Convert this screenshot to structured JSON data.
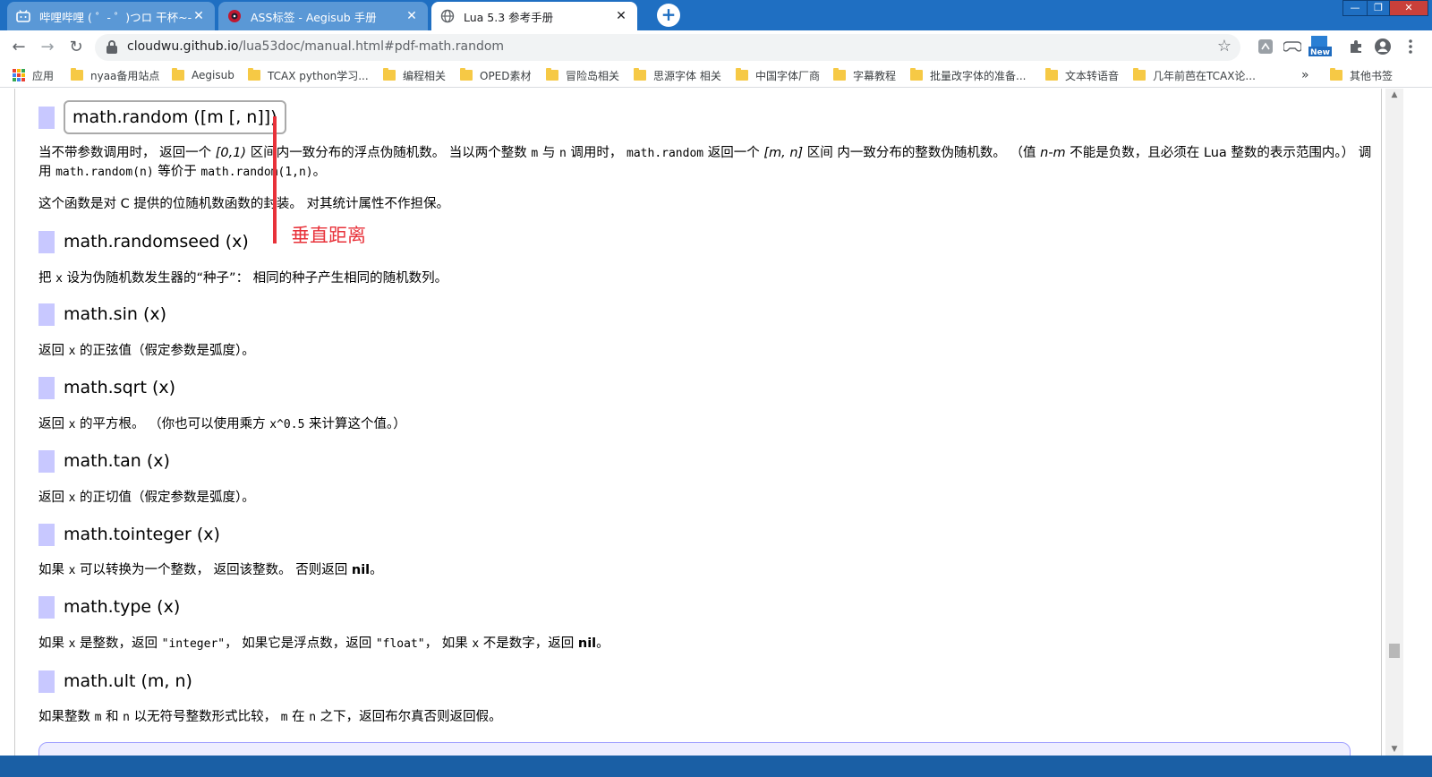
{
  "tabs": [
    {
      "title": "哔哩哔哩 ( ゜- ゜)つロ 干杯~-bili",
      "icon": "bilibili-icon",
      "close": "✕"
    },
    {
      "title": "ASS标签 - Aegisub 手册",
      "icon": "aegisub-icon",
      "close": "✕"
    },
    {
      "title": "Lua 5.3 参考手册",
      "icon": "globe-icon",
      "close": "✕",
      "active": true
    }
  ],
  "new_tab": "+",
  "window_controls": {
    "minimize": "—",
    "maximize": "❐",
    "close": "✕"
  },
  "toolbar": {
    "back": "←",
    "forward": "→",
    "reload": "↻",
    "url_host": "cloudwu.github.io",
    "url_path": "/lua53doc/manual.html#pdf-math.random",
    "star": "☆",
    "new_badge": "New",
    "extensions": [
      "screenshot-icon",
      "gamepad-icon",
      "new-badge-icon",
      "puzzle-icon",
      "profile-icon",
      "menu-dots-icon"
    ]
  },
  "bookmarks": {
    "apps": "应用",
    "items": [
      "nyaa备用站点",
      "Aegisub",
      "TCAX python学习...",
      "编程相关",
      "OPED素材",
      "冒险岛相关",
      "思源字体 相关",
      "中国字体厂商",
      "字幕教程",
      "批量改字体的准备...",
      "文本转语音",
      "几年前芭在TCAX论..."
    ],
    "overflow": "»",
    "other": "其他书签"
  },
  "doc": {
    "random": {
      "name": "math.random ([m [, n]])",
      "p1_a": "当不带参数调用时， 返回一个 ",
      "p1_b": "[0,1)",
      "p1_c": " 区间内一致分布的浮点伪随机数。 当以两个整数 ",
      "p1_d": "m",
      "p1_e": " 与 ",
      "p1_f": "n",
      "p1_g": " 调用时， ",
      "p1_h": "math.random",
      "p1_i": " 返回一个 ",
      "p1_j": "[m, n]",
      "p1_k": " 区间 内一致分布的整数伪随机数。 （值 ",
      "p1_l": "n-m",
      "p1_m": " 不能是负数，且必须在 Lua 整数的表示范围内。） 调用 ",
      "p1_n": "math.random(n)",
      "p1_o": " 等价于 ",
      "p1_p": "math.random(1,n)",
      "p1_q": "。",
      "p2": "这个函数是对 C 提供的位随机数函数的封装。 对其统计属性不作担保。"
    },
    "randomseed": {
      "name": "math.randomseed (x)",
      "p_a": "把 ",
      "p_b": "x",
      "p_c": " 设为伪随机数发生器的“种子”： 相同的种子产生相同的随机数列。"
    },
    "sin": {
      "name": "math.sin (x)",
      "p_a": "返回 ",
      "p_b": "x",
      "p_c": " 的正弦值（假定参数是弧度）。"
    },
    "sqrt": {
      "name": "math.sqrt (x)",
      "p_a": "返回 ",
      "p_b": "x",
      "p_c": " 的平方根。 （你也可以使用乘方 ",
      "p_d": "x^0.5",
      "p_e": " 来计算这个值。）"
    },
    "tan": {
      "name": "math.tan (x)",
      "p_a": "返回 ",
      "p_b": "x",
      "p_c": " 的正切值（假定参数是弧度）。"
    },
    "tointeger": {
      "name": "math.tointeger (x)",
      "p_a": "如果 ",
      "p_b": "x",
      "p_c": " 可以转换为一个整数， 返回该整数。 否则返回 ",
      "p_d": "nil",
      "p_e": "。"
    },
    "type": {
      "name": "math.type (x)",
      "p_a": "如果 ",
      "p_b": "x",
      "p_c": " 是整数，返回 ",
      "p_d": "\"integer\"",
      "p_e": "， 如果它是浮点数，返回 ",
      "p_f": "\"float\"",
      "p_g": "， 如果 ",
      "p_h": "x",
      "p_i": " 不是数字，返回 ",
      "p_j": "nil",
      "p_k": "。"
    },
    "ult": {
      "name": "math.ult (m, n)",
      "p_a": "如果整数 ",
      "p_b": "m",
      "p_c": " 和 ",
      "p_d": "n",
      "p_e": " 以无符号整数形式比较， ",
      "p_f": "m",
      "p_g": " 在 ",
      "p_h": "n",
      "p_i": " 之下，返回布尔真否则返回假。"
    }
  },
  "annotation": {
    "label": "垂直距离",
    "color": "#e8323a"
  },
  "colors": {
    "tabstrip": "#1f6fc2",
    "anchor_square": "#c8c8ff",
    "annotation": "#e8323a"
  }
}
